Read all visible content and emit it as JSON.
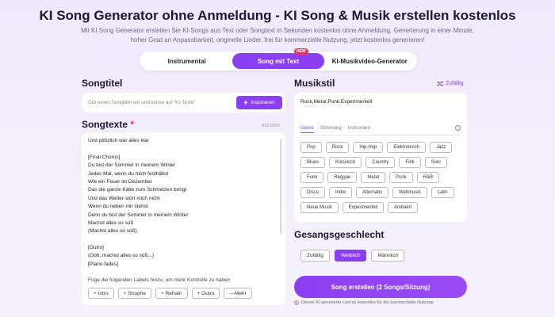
{
  "header": {
    "title": "KI Song Generator ohne Anmeldung - KI Song & Musik erstellen kostenlos",
    "subtitle": "Mit KI Song Generator erstellen Sie KI-Songs aus Text oder Songtext in Sekunden kostenlos ohne Anmeldung. Generierung in einer Minute, hoher Grad an Anpassbarkeit, originelle Lieder, frei für kommerzielle Nutzung, jetzt kostenlos generieren!"
  },
  "mode_tabs": [
    {
      "label": "Instrumental",
      "active": false
    },
    {
      "label": "Song mit Text",
      "active": true,
      "badge": "NEW"
    },
    {
      "label": "KI-Musikvideo-Generator",
      "active": false
    }
  ],
  "songtitle": {
    "heading": "Songtitel",
    "placeholder": "Gib einen Songtitel ein und klicke auf 'KI-Texte'",
    "inspire_label": "Inspirieren"
  },
  "lyrics": {
    "heading": "Songtexte",
    "required_mark": "*",
    "counter": "831/3000",
    "lines": [
      "Und plötzlich war alles klar",
      "",
      "[Final Chorus]",
      "Du bist der Sommer in meinem Winter",
      "Jedes Mal, wenn du mich festhältst",
      "Wie ein Feuer im Dezember",
      "Das die ganze Kälte zum Schmelzen bringt",
      "Und das Wetter stört mich nicht",
      "Wenn du neben mir stehst",
      "Denn du bist der Sommer in meinem Winter",
      "Machst alles so süß",
      "(Machst alles so süß)",
      "",
      "[Outro]",
      "(Ooh, machst alles so süß...)",
      "[Piano fades]"
    ],
    "labels_hint": "Füge die folgenden Labels hinzu, um mehr Kontrolle zu haben",
    "label_buttons": [
      "+ Intro",
      "+ Strophe",
      "+ Refrain",
      "+ Outro",
      "—Mehr"
    ]
  },
  "music_style": {
    "heading": "Musikstil",
    "random_label": "Zufällig",
    "value": "Rock,Metal,Punk,Experimentell",
    "tabs": [
      {
        "label": "Genre",
        "active": true
      },
      {
        "label": "Stimmung",
        "active": false
      },
      {
        "label": "Instrument",
        "active": false
      }
    ],
    "genres": [
      "Pop",
      "Rock",
      "Hip-Hop",
      "Elektronisch",
      "Jazz",
      "Blues",
      "Klassisch",
      "Country",
      "Folk",
      "Soul",
      "Funk",
      "Reggae",
      "Metal",
      "Punk",
      "R&B",
      "Disco",
      "Indie",
      "Alternativ",
      "Weltmusik",
      "Latin",
      "Neue Musik",
      "Experimentell",
      "Ambient"
    ]
  },
  "gender": {
    "heading": "Gesangsgeschlecht",
    "options": [
      {
        "label": "Zufällig",
        "active": false
      },
      {
        "label": "Weiblich",
        "active": true
      },
      {
        "label": "Männlich",
        "active": false
      }
    ]
  },
  "create": {
    "label": "Song erstellen (2 Songs/Sitzung)",
    "note": "Dieses KI-generierte Lied ist kostenlos für die kommerzielle Nutzung"
  },
  "colors": {
    "accent": "#8a3ff2",
    "required": "#e5346a"
  }
}
